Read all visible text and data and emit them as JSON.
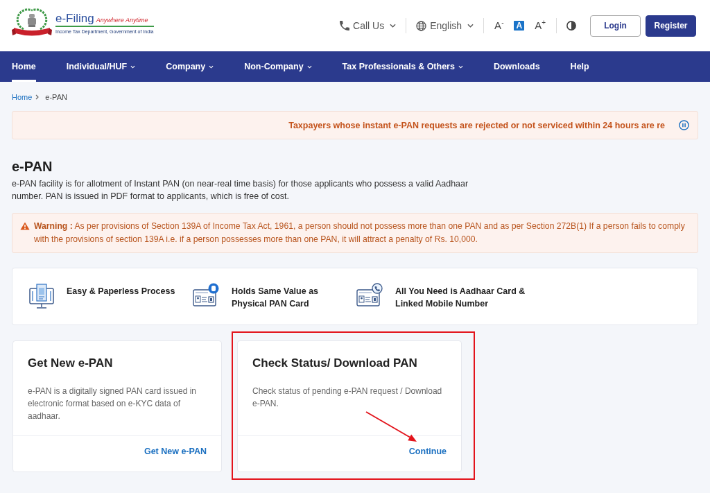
{
  "header": {
    "logo": {
      "title": "e-Filing",
      "tagline": "Anywhere Anytime",
      "subtitle": "Income Tax Department, Government of India"
    },
    "menus": [
      {
        "kind": "phone",
        "label": "Call Us"
      },
      {
        "kind": "globe",
        "label": "English"
      }
    ],
    "text_size": [
      {
        "label": "A$^{-}$",
        "selected": false
      },
      {
        "label": "A",
        "selected": true
      },
      {
        "label": "A$^{+}$",
        "selected": false
      }
    ],
    "buttons": [
      {
        "kind": "outline",
        "label": "Login"
      },
      {
        "kind": "primary",
        "label": "Register"
      }
    ]
  },
  "nav": [
    {
      "label": "Home",
      "selected": true,
      "dropdown": false
    },
    {
      "label": "Individual/HUF",
      "selected": false,
      "dropdown": true
    },
    {
      "label": "Company",
      "selected": false,
      "dropdown": true
    },
    {
      "label": "Non-Company",
      "selected": false,
      "dropdown": true
    },
    {
      "label": "Tax Professionals & Others",
      "selected": false,
      "dropdown": true
    },
    {
      "label": "Downloads",
      "selected": false,
      "dropdown": false
    },
    {
      "label": "Help",
      "selected": false,
      "dropdown": false
    }
  ],
  "breadcrumb": [
    {
      "label": "Home",
      "current": false
    },
    {
      "label": "e-PAN",
      "current": true
    }
  ],
  "announcement": {
    "text": "Taxpayers whose instant e-PAN requests are rejected or not serviced within 24 hours are re",
    "playing": true
  },
  "page": {
    "title": "e-PAN",
    "description": "e-PAN facility is for allotment of Instant PAN (on near-real time basis) for those applicants who possess a valid Aadhaar number. PAN is issued in PDF format to applicants, which is free of cost."
  },
  "warning": {
    "text": "**Warning :** As per provisions of Section 139A of Income Tax Act, 1961, a person should not possess more than one PAN and as per Section 272B(1) If a person fails to comply with the provisions of section 139A i.e. if a person possesses more than one PAN, it will attract a penalty of Rs. 10,000."
  },
  "features": [
    {
      "kind": "monitor",
      "text": "Easy & Paperless Process"
    },
    {
      "kind": "badge",
      "text": "Holds Same Value as Physical PAN Card"
    },
    {
      "kind": "phone",
      "text": "All You Need is Aadhaar Card & Linked Mobile Number"
    }
  ],
  "cards": [
    {
      "title": "Get New e-PAN",
      "description": "e-PAN is a digitally signed PAN card issued in electronic format based on e-KYC data of aadhaar.",
      "link": "Get New e-PAN",
      "highlighted": false
    },
    {
      "title": "Check Status/ Download PAN",
      "description": "Check status of pending e-PAN request / Download e-PAN.",
      "link": "Continue",
      "highlighted": true
    }
  ]
}
